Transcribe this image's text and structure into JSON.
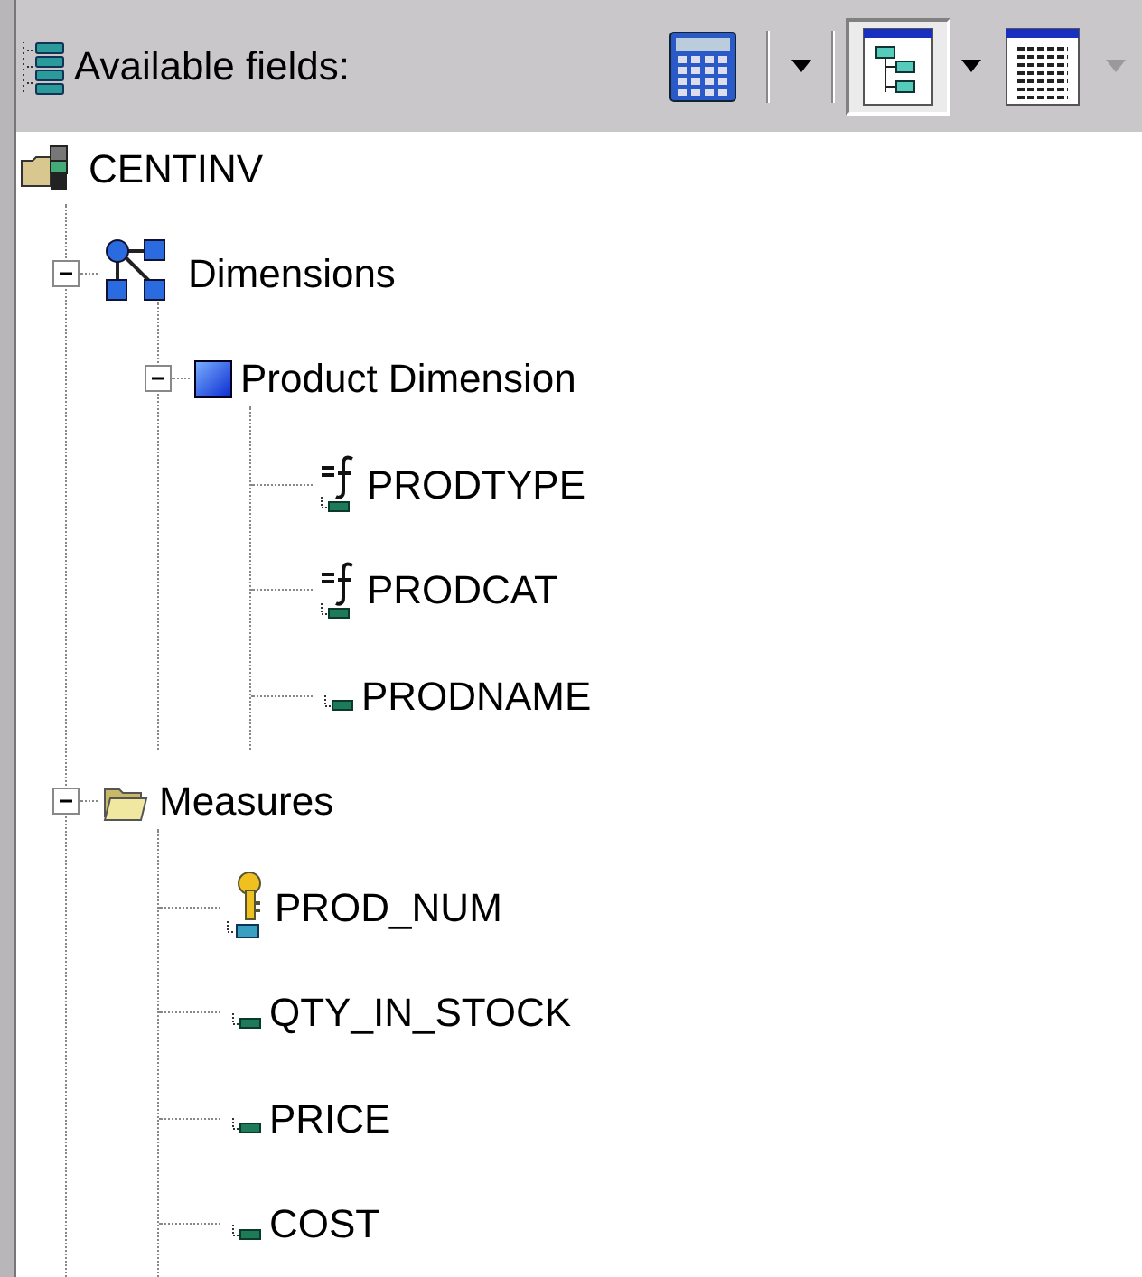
{
  "toolbar": {
    "title": "Available fields:",
    "buttons": [
      {
        "kind": "calculator",
        "selected": false
      },
      {
        "kind": "separator"
      },
      {
        "kind": "dropdown",
        "disabled": false
      },
      {
        "kind": "separator"
      },
      {
        "kind": "tree",
        "selected": true
      },
      {
        "kind": "dropdown",
        "disabled": false
      },
      {
        "kind": "table",
        "selected": false
      },
      {
        "kind": "dropdown",
        "disabled": true
      }
    ]
  },
  "tree": [
    {
      "label": "CENTINV",
      "kind": "database",
      "children": [
        {
          "label": "Dimensions",
          "kind": "dimensions",
          "expanded": true,
          "children": [
            {
              "label": "Product Dimension",
              "kind": "dimension",
              "expanded": true,
              "children": [
                {
                  "label": "PRODTYPE",
                  "kind": "computed"
                },
                {
                  "label": "PRODCAT",
                  "kind": "computed"
                },
                {
                  "label": "PRODNAME",
                  "kind": "column"
                }
              ]
            }
          ]
        },
        {
          "label": "Measures",
          "kind": "folder",
          "expanded": true,
          "children": [
            {
              "label": "PROD_NUM",
              "kind": "key"
            },
            {
              "label": "QTY_IN_STOCK",
              "kind": "column"
            },
            {
              "label": "PRICE",
              "kind": "column"
            },
            {
              "label": "COST",
              "kind": "column"
            }
          ]
        }
      ]
    }
  ]
}
